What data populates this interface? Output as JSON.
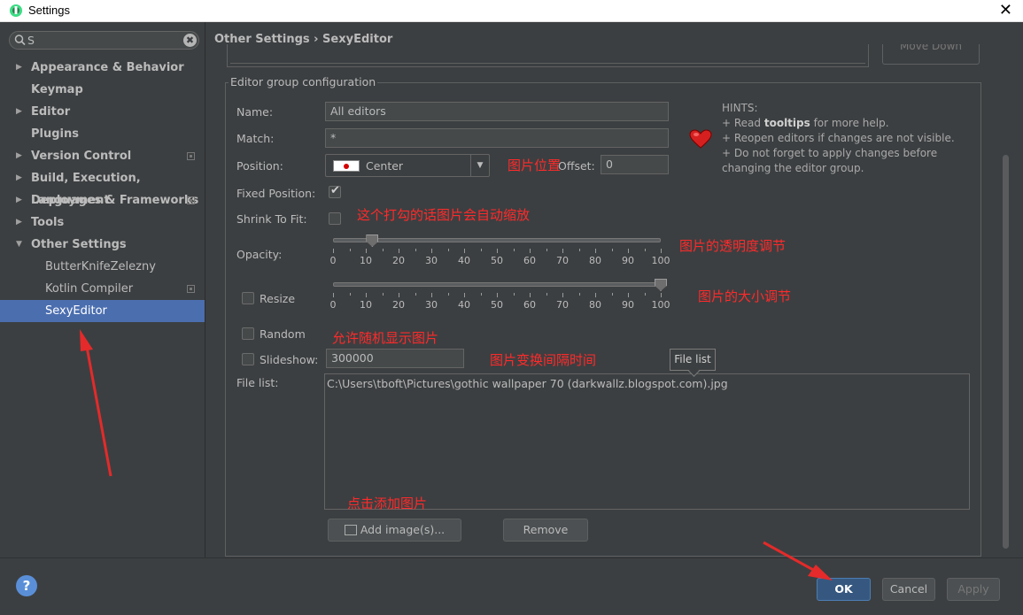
{
  "window": {
    "title": "Settings",
    "close_glyph": "✕"
  },
  "search": {
    "value": "S",
    "clear_glyph": "✖"
  },
  "sidebar": {
    "items": [
      {
        "label": "Appearance & Behavior",
        "arrow": "▶"
      },
      {
        "label": "Keymap",
        "arrow": ""
      },
      {
        "label": "Editor",
        "arrow": "▶"
      },
      {
        "label": "Plugins",
        "arrow": ""
      },
      {
        "label": "Version Control",
        "arrow": "▶"
      },
      {
        "label": "Build, Execution, Deployment",
        "arrow": "▶"
      },
      {
        "label": "Languages & Frameworks",
        "arrow": "▶"
      },
      {
        "label": "Tools",
        "arrow": "▶"
      },
      {
        "label": "Other Settings",
        "arrow": "▼"
      },
      {
        "label": "ButterKnifeZelezny",
        "arrow": ""
      },
      {
        "label": "Kotlin Compiler",
        "arrow": ""
      },
      {
        "label": "SexyEditor",
        "arrow": ""
      }
    ],
    "selected": "SexyEditor"
  },
  "breadcrumb": "Other Settings › SexyEditor",
  "top": {
    "move_down_label": "Move Down"
  },
  "group": {
    "title": "Editor group configuration",
    "name_label": "Name:",
    "name_value": "All editors",
    "match_label": "Match:",
    "match_value": "*",
    "position_label": "Position:",
    "position_value": "Center",
    "offset_label": "Offset:",
    "offset_value": "0",
    "fixed_label": "Fixed Position:",
    "fixed_checked": true,
    "shrink_label": "Shrink To Fit:",
    "shrink_checked": false,
    "opacity_label": "Opacity:",
    "opacity_value": 12,
    "resize_label": "Resize",
    "resize_checked": false,
    "resize_value": 100,
    "slider_ticks": [
      "0",
      "10",
      "20",
      "30",
      "40",
      "50",
      "60",
      "70",
      "80",
      "90",
      "100"
    ],
    "random_label": "Random",
    "random_checked": false,
    "slideshow_label": "Slideshow:",
    "slideshow_checked": false,
    "slideshow_value": "300000",
    "filelist_label": "File list:",
    "filelist_tooltip": "File list",
    "files": [
      "C:\\Users\\tboft\\Pictures\\gothic wallpaper 70 (darkwallz.blogspot.com).jpg"
    ],
    "add_button": "Add image(s)...",
    "remove_button": "Remove"
  },
  "hints": {
    "title": "HINTS:",
    "line1_pre": "+ Read ",
    "line1_bold": "tooltips",
    "line1_post": " for more help.",
    "line2": "+ Reopen editors if changes are not visible.",
    "line3": "+ Do not forget to apply changes before",
    "line4": "changing the editor group."
  },
  "annotations": {
    "position": "图片位置",
    "shrink": "这个打勾的话图片会自动缩放",
    "opacity": "图片的透明度调节",
    "resize": "图片的大小调节",
    "random": "允许随机显示图片",
    "slideshow": "图片变换间隔时间",
    "add": "点击添加图片"
  },
  "footer": {
    "help": "?",
    "ok": "OK",
    "cancel": "Cancel",
    "apply": "Apply"
  },
  "colors": {
    "background": "#3c3f41",
    "selection": "#4b6eaf",
    "annotation_red": "#ff2a2a",
    "ok_blue": "#365880"
  }
}
